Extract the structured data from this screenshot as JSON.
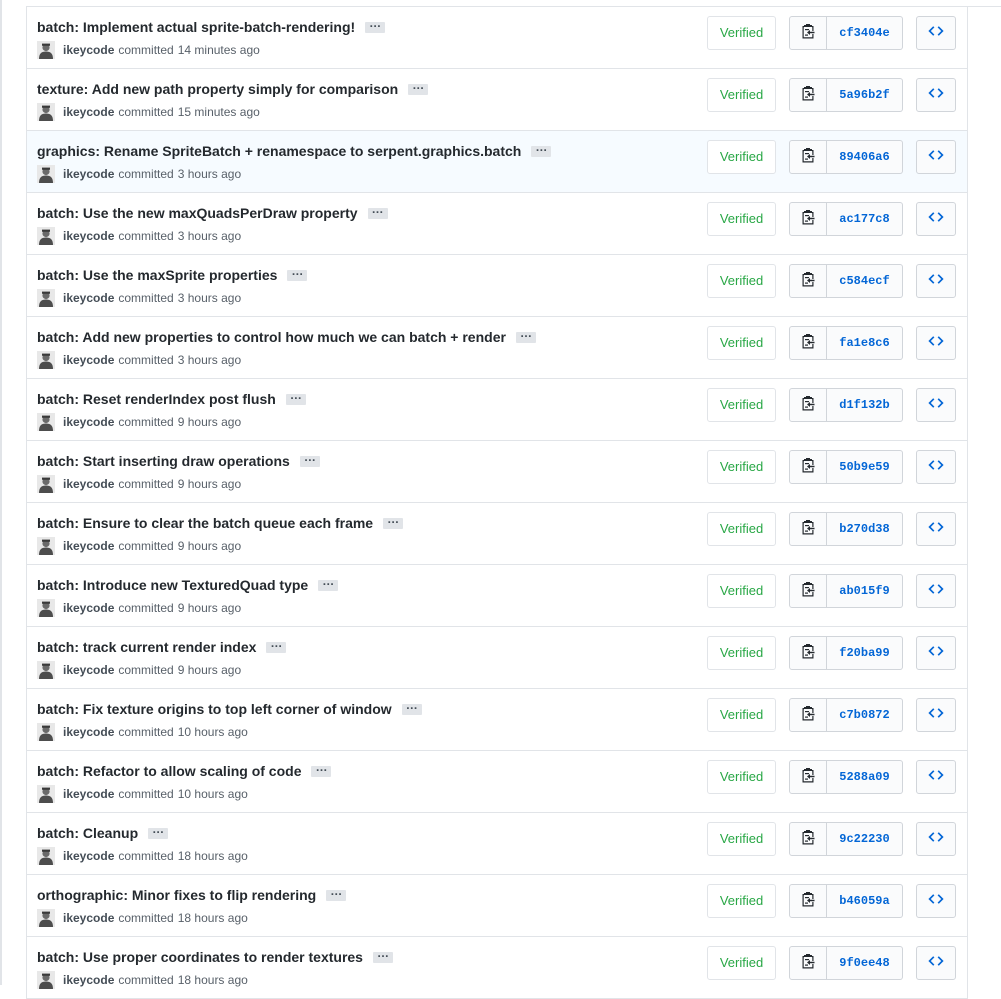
{
  "commits": [
    {
      "message": "batch: Implement actual sprite-batch-rendering!",
      "author": "ikeycode",
      "when": "14 minutes ago",
      "verified": "Verified",
      "sha": "cf3404e"
    },
    {
      "message": "texture: Add new path property simply for comparison",
      "author": "ikeycode",
      "when": "15 minutes ago",
      "verified": "Verified",
      "sha": "5a96b2f"
    },
    {
      "message": "graphics: Rename SpriteBatch + renamespace to serpent.graphics.batch",
      "author": "ikeycode",
      "when": "3 hours ago",
      "verified": "Verified",
      "sha": "89406a6"
    },
    {
      "message": "batch: Use the new maxQuadsPerDraw property",
      "author": "ikeycode",
      "when": "3 hours ago",
      "verified": "Verified",
      "sha": "ac177c8"
    },
    {
      "message": "batch: Use the maxSprite properties",
      "author": "ikeycode",
      "when": "3 hours ago",
      "verified": "Verified",
      "sha": "c584ecf"
    },
    {
      "message": "batch: Add new properties to control how much we can batch + render",
      "author": "ikeycode",
      "when": "3 hours ago",
      "verified": "Verified",
      "sha": "fa1e8c6"
    },
    {
      "message": "batch: Reset renderIndex post flush",
      "author": "ikeycode",
      "when": "9 hours ago",
      "verified": "Verified",
      "sha": "d1f132b"
    },
    {
      "message": "batch: Start inserting draw operations",
      "author": "ikeycode",
      "when": "9 hours ago",
      "verified": "Verified",
      "sha": "50b9e59"
    },
    {
      "message": "batch: Ensure to clear the batch queue each frame",
      "author": "ikeycode",
      "when": "9 hours ago",
      "verified": "Verified",
      "sha": "b270d38"
    },
    {
      "message": "batch: Introduce new TexturedQuad type",
      "author": "ikeycode",
      "when": "9 hours ago",
      "verified": "Verified",
      "sha": "ab015f9"
    },
    {
      "message": "batch: track current render index",
      "author": "ikeycode",
      "when": "9 hours ago",
      "verified": "Verified",
      "sha": "f20ba99"
    },
    {
      "message": "batch: Fix texture origins to top left corner of window",
      "author": "ikeycode",
      "when": "10 hours ago",
      "verified": "Verified",
      "sha": "c7b0872"
    },
    {
      "message": "batch: Refactor to allow scaling of code",
      "author": "ikeycode",
      "when": "10 hours ago",
      "verified": "Verified",
      "sha": "5288a09"
    },
    {
      "message": "batch: Cleanup",
      "author": "ikeycode",
      "when": "18 hours ago",
      "verified": "Verified",
      "sha": "9c22230"
    },
    {
      "message": "orthographic: Minor fixes to flip rendering",
      "author": "ikeycode",
      "when": "18 hours ago",
      "verified": "Verified",
      "sha": "b46059a"
    },
    {
      "message": "batch: Use proper coordinates to render textures",
      "author": "ikeycode",
      "when": "18 hours ago",
      "verified": "Verified",
      "sha": "9f0ee48"
    }
  ],
  "committed_word": "committed",
  "highlighted_index": 2,
  "colors": {
    "verified": "#28a745",
    "sha": "#0366d6",
    "highlight": "#f6fbff"
  },
  "icons": {
    "copy": "clipboard-icon",
    "browse": "code-icon",
    "avatar": "user-avatar"
  }
}
